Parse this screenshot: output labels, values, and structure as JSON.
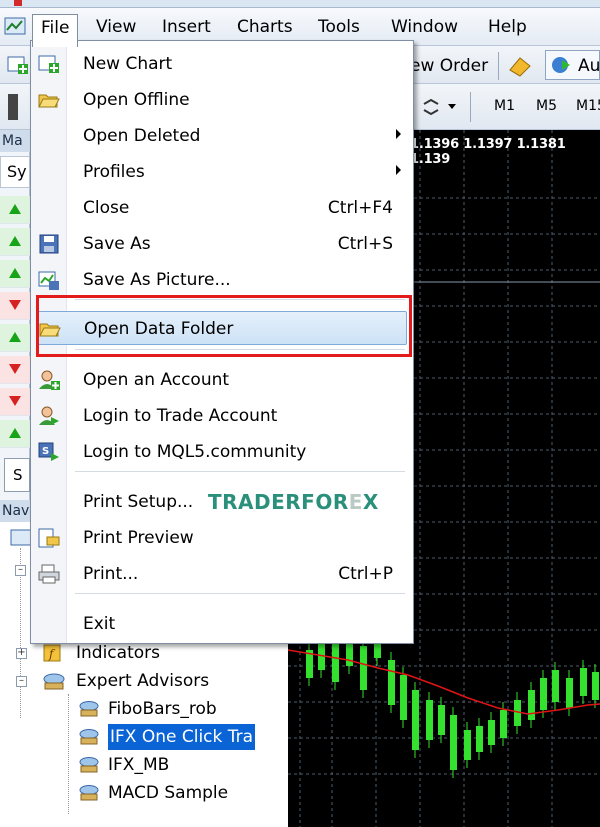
{
  "menubar": {
    "items": [
      "File",
      "View",
      "Insert",
      "Charts",
      "Tools",
      "Window",
      "Help"
    ],
    "open_item": "File"
  },
  "toolbar": {
    "new_order_label": "ew Order",
    "auto_label": "Au",
    "timeframes": [
      "M1",
      "M5",
      "M15"
    ]
  },
  "market_watch": {
    "header": "Ma",
    "column": "Sy",
    "tab": "S",
    "rows": [
      "up",
      "up",
      "up",
      "down",
      "up",
      "down",
      "down",
      "up"
    ]
  },
  "navigator": {
    "header": "Nav",
    "items": [
      {
        "label": "Indicators",
        "icon": "indicators-icon"
      },
      {
        "label": "Expert Advisors",
        "icon": "expert-advisors-icon"
      },
      {
        "label": "FiboBars_rob",
        "icon": "expert-icon"
      },
      {
        "label": "IFX One Click Tra",
        "icon": "expert-icon",
        "selected": true
      },
      {
        "label": "IFX_MB",
        "icon": "expert-icon"
      },
      {
        "label": "MACD Sample",
        "icon": "expert-icon"
      }
    ]
  },
  "chart": {
    "price_labels": "1.1396 1.1397 1.1381 1.139"
  },
  "file_menu": {
    "items": [
      {
        "label": "New Chart",
        "shortcut": "",
        "icon": "new-chart-icon"
      },
      {
        "label": "Open Offline",
        "shortcut": "",
        "icon": "open-offline-icon"
      },
      {
        "label": "Open Deleted",
        "shortcut": "",
        "submenu": true
      },
      {
        "label": "Profiles",
        "shortcut": "",
        "submenu": true
      },
      {
        "label": "Close",
        "shortcut": "Ctrl+F4"
      },
      {
        "label": "Save As",
        "shortcut": "Ctrl+S",
        "icon": "save-icon"
      },
      {
        "label": "Save As Picture...",
        "shortcut": "",
        "icon": "save-picture-icon"
      },
      {
        "label": "Open Data Folder",
        "shortcut": "",
        "icon": "folder-icon",
        "highlighted": true
      },
      {
        "label": "Open an Account",
        "shortcut": "",
        "icon": "account-icon"
      },
      {
        "label": "Login to Trade Account",
        "shortcut": "",
        "icon": "login-icon"
      },
      {
        "label": "Login to MQL5.community",
        "shortcut": "",
        "icon": "mql5-icon"
      },
      {
        "label": "Print Setup...",
        "shortcut": ""
      },
      {
        "label": "Print Preview",
        "shortcut": "",
        "icon": "print-preview-icon"
      },
      {
        "label": "Print...",
        "shortcut": "Ctrl+P",
        "icon": "printer-icon"
      },
      {
        "label": "Exit",
        "shortcut": ""
      }
    ]
  },
  "watermark": {
    "part1": "TRADERFOR",
    "part2": "E",
    "part3": "X"
  },
  "colors": {
    "highlight_border": "#e31b1b",
    "selection": "#0a64d6",
    "bull": "#34e12e",
    "bear_line": "#e01414"
  }
}
